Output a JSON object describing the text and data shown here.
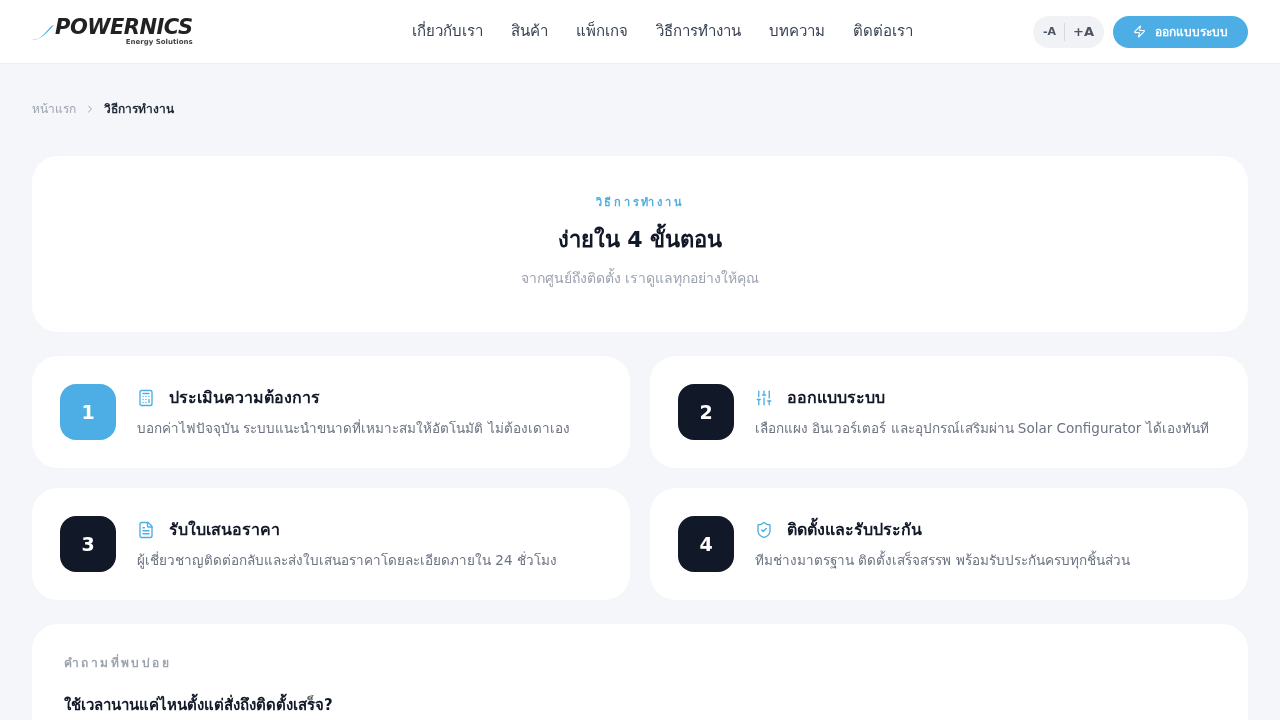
{
  "header": {
    "logo": {
      "name": "POWERNICS",
      "tagline": "Energy Solutions"
    },
    "nav": [
      "เกี่ยวกับเรา",
      "สินค้า",
      "แพ็กเกจ",
      "วิธีการทำงาน",
      "บทความ",
      "ติดต่อเรา"
    ],
    "font_size_controls": [
      "-A",
      "+A"
    ],
    "cta_button": "ออกแบบระบบ"
  },
  "breadcrumb": [
    {
      "label": "หน้าแรก",
      "current": false
    },
    {
      "label": "วิธีการทำงาน",
      "current": true
    }
  ],
  "hero": {
    "eyebrow": "วิธีการทำงาน",
    "title": "ง่ายใน 4 ขั้นตอน",
    "subtitle": "จากศูนย์ถึงติดตั้ง เราดูแลทุกอย่างให้คุณ"
  },
  "steps": [
    {
      "number": "1",
      "kind": "estimate",
      "highlighted": true,
      "title": "ประเมินความต้องการ",
      "description": "บอกค่าไฟปัจจุบัน ระบบแนะนำขนาดที่เหมาะสมให้อัตโนมัติ ไม่ต้องเดาเอง"
    },
    {
      "number": "2",
      "kind": "design",
      "highlighted": false,
      "title": "ออกแบบระบบ",
      "description": "เลือกแผง อินเวอร์เตอร์ และอุปกรณ์เสริมผ่าน Solar Configurator ได้เองทันที"
    },
    {
      "number": "3",
      "kind": "quote",
      "highlighted": false,
      "title": "รับใบเสนอราคา",
      "description": "ผู้เชี่ยวชาญติดต่อกลับและส่งใบเสนอราคาโดยละเอียดภายใน 24 ชั่วโมง"
    },
    {
      "number": "4",
      "kind": "install",
      "highlighted": false,
      "title": "ติดตั้งและรับประกัน",
      "description": "ทีมช่างมาตรฐาน ติดตั้งเสร็จสรรพ พร้อมรับประกันครบทุกชิ้นส่วน"
    }
  ],
  "faq": {
    "eyebrow": "คำถามที่พบบ่อย",
    "questions": [
      "ใช้เวลานานแค่ไหนตั้งแต่สั่งถึงติดตั้งเสร็จ?"
    ]
  }
}
